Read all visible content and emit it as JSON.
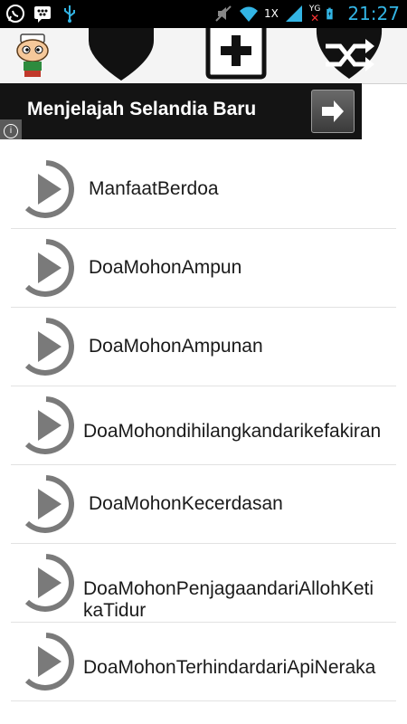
{
  "status_bar": {
    "left_icons": [
      "whatsapp-icon",
      "bbm-icon",
      "usb-icon"
    ],
    "right_icons": [
      "mute-icon",
      "wifi-icon",
      "signal-icon",
      "no-signal-icon",
      "battery-icon"
    ],
    "network_label": "1X",
    "data_label": "YG",
    "time": "21:27"
  },
  "toolbar": {
    "icons": [
      "avatar-icon",
      "heart-icon",
      "add-icon",
      "shuffle-icon"
    ]
  },
  "ad": {
    "text": "Menjelajah Selandia Baru",
    "info": "i"
  },
  "list": {
    "items": [
      {
        "label": "ManfaatBerdoa"
      },
      {
        "label": "DoaMohonAmpun"
      },
      {
        "label": "DoaMohonAmpunan"
      },
      {
        "label": "DoaMohondihilangkandarikefakiran"
      },
      {
        "label": "DoaMohonKecerdasan"
      },
      {
        "label": "DoaMohonPenjagaandariAllohKetikaTidur"
      },
      {
        "label": "DoaMohonTerhindardariApiNeraka"
      }
    ]
  },
  "colors": {
    "status_accent": "#33b5e5",
    "icon_dark": "#1a1a1a",
    "play_gray": "#7a7a7a"
  }
}
